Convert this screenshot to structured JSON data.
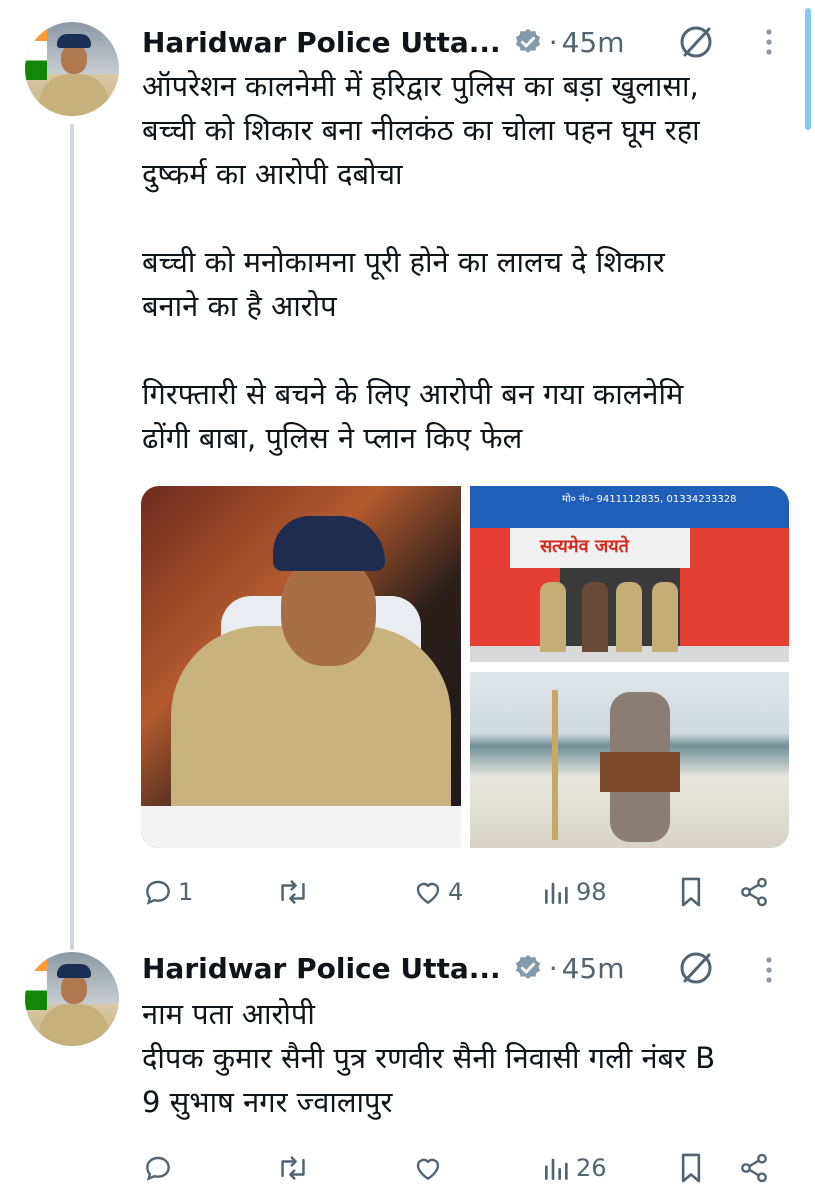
{
  "tweets": [
    {
      "author": "Haridwar Police Utta...",
      "separator": "·",
      "time": "45m",
      "text": "ऑपरेशन कालनेमी में हरिद्वार पुलिस का बड़ा खुलासा,\nबच्ची को शिकार बना नीलकंठ का चोला पहन घूम रहा\nदुष्कर्म का आरोपी दबोचा\n\nबच्ची को मनोकामना पूरी होने का लालच दे शिकार\nबनाने का है आरोप\n\nगिरफ्तारी से बचने के लिए आरोपी बन गया कालनेमि\nढोंगी बाबा, पुलिस ने प्लान किए फेल",
      "images": [
        {
          "signage": ""
        },
        {
          "signage": "सत्यमेव जयते",
          "phone": "मो० नं०- 9411112835, 01334233328"
        },
        {
          "signage": ""
        }
      ],
      "replies": "1",
      "reposts": "",
      "likes": "4",
      "views": "98"
    },
    {
      "author": "Haridwar Police Utta...",
      "separator": "·",
      "time": "45m",
      "text": "नाम पता आरोपी\nदीपक कुमार सैनी पुत्र रणवीर सैनी निवासी गली नंबर B\n9 सुभाष नगर ज्वालापुर",
      "replies": "",
      "reposts": "",
      "likes": "",
      "views": "26"
    }
  ],
  "icons": {
    "verified": "verified-badge-icon",
    "grok": "grok-icon",
    "more": "more-vertical-icon",
    "reply": "reply-icon",
    "repost": "repost-icon",
    "like": "heart-icon",
    "views": "views-bar-chart-icon",
    "bookmark": "bookmark-icon",
    "share": "share-icon"
  },
  "colors": {
    "text": "#0f1419",
    "meta": "#536471",
    "thread_line": "#cfd9de",
    "accent": "#1d9bf0"
  }
}
